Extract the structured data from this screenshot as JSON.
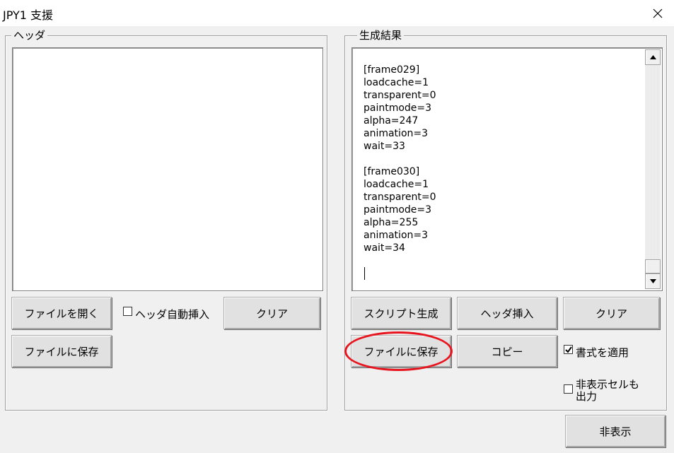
{
  "window": {
    "title": "JPY1 支援",
    "close_icon": "close-icon"
  },
  "header_panel": {
    "legend": "ヘッダ",
    "text": "",
    "open_button": "ファイルを開く",
    "auto_insert_checkbox": {
      "label": "ヘッダ自動挿入",
      "checked": false
    },
    "clear_button": "クリア",
    "save_button": "ファイルに保存"
  },
  "result_panel": {
    "legend": "生成結果",
    "output_text": "[frame029]\nloadcache=1\ntransparent=0\npaintmode=3\nalpha=247\nanimation=3\nwait=33\n\n[frame030]\nloadcache=1\ntransparent=0\npaintmode=3\nalpha=255\nanimation=3\nwait=34\n",
    "script_gen_button": "スクリプト生成",
    "header_insert_button": "ヘッダ挿入",
    "clear_button": "クリア",
    "save_button": "ファイルに保存",
    "copy_button": "コピー",
    "apply_format_checkbox": {
      "label": "書式を適用",
      "checked": true
    },
    "output_hidden_cells_checkbox": {
      "label": "非表示セルも\n出力",
      "checked": false
    }
  },
  "hide_button": "非表示",
  "annotation": {
    "color": "#e8141e"
  },
  "icons": {
    "scroll_up": "arrow-up-icon",
    "scroll_down": "arrow-down-icon",
    "check": "checkmark-icon"
  }
}
